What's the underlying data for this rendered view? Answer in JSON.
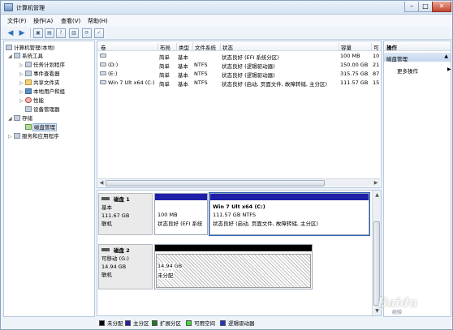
{
  "window": {
    "title": "计算机管理",
    "min": "–",
    "max": "□",
    "close": "✕"
  },
  "menu": [
    {
      "label": "文件(F)"
    },
    {
      "label": "操作(A)"
    },
    {
      "label": "查看(V)"
    },
    {
      "label": "帮助(H)"
    }
  ],
  "toolbar": [
    {
      "icon": "back-arrow-icon",
      "glyph": "◀"
    },
    {
      "icon": "forward-arrow-icon",
      "glyph": "▶"
    },
    {
      "icon": "up-level-icon",
      "glyph": "▣"
    },
    {
      "icon": "show-hide-tree-icon",
      "glyph": "▤"
    },
    {
      "icon": "help-icon",
      "glyph": "?"
    },
    {
      "icon": "properties-icon",
      "glyph": "▥"
    },
    {
      "icon": "refresh-icon",
      "glyph": "⟳"
    },
    {
      "icon": "export-list-icon",
      "glyph": "✓"
    }
  ],
  "tree": [
    {
      "label": "计算机管理(本地)",
      "expander": "",
      "icon": "gray"
    },
    {
      "label": "系统工具",
      "expander": "◢",
      "icon": "gray"
    },
    {
      "label": "任务计划程序",
      "expander": "▷",
      "icon": "gray"
    },
    {
      "label": "事件查看器",
      "expander": "▷",
      "icon": "gray"
    },
    {
      "label": "共享文件夹",
      "expander": "▷",
      "icon": "yellow"
    },
    {
      "label": "本地用户和组",
      "expander": "▷",
      "icon": "blue"
    },
    {
      "label": "性能",
      "expander": "▷",
      "icon": "red"
    },
    {
      "label": "设备管理器",
      "expander": "",
      "icon": "gray"
    },
    {
      "label": "存储",
      "expander": "◢",
      "icon": "gray"
    },
    {
      "label": "磁盘管理",
      "expander": "",
      "icon": "green"
    },
    {
      "label": "服务和应用程序",
      "expander": "▷",
      "icon": "gray"
    }
  ],
  "volumes": {
    "columns": [
      "卷",
      "布局",
      "类型",
      "文件系统",
      "状态",
      "容量",
      "可"
    ],
    "rows": [
      [
        "",
        "简单",
        "基本",
        "",
        "状态良好 (EFI 系统分区)",
        "100 MB",
        "10"
      ],
      [
        "(D:)",
        "简单",
        "基本",
        "NTFS",
        "状态良好 (逻辑驱动器)",
        "150.00 GB",
        "21"
      ],
      [
        "(E:)",
        "简单",
        "基本",
        "NTFS",
        "状态良好 (逻辑驱动器)",
        "315.75 GB",
        "87"
      ],
      [
        "Win 7 Ult x64 (C:)",
        "简单",
        "基本",
        "NTFS",
        "状态良好 (启动, 页面文件, 故障转储, 主分区)",
        "111.57 GB",
        "15"
      ]
    ]
  },
  "disks": [
    {
      "name": "磁盘 1",
      "type": "基本",
      "size": "111.67 GB",
      "status": "联机",
      "partitions": [
        {
          "title": "",
          "size": "100 MB",
          "status": "状态良好 (EFI 系统",
          "color": "#1f1fa8",
          "selected": false
        },
        {
          "title": "Win 7 Ult x64  (C:)",
          "size": "111.57 GB NTFS",
          "status": "状态良好 (启动, 页面文件, 故障转储, 主分区)",
          "color": "#1f1fa8",
          "selected": true
        }
      ]
    },
    {
      "name": "磁盘 2",
      "type": "可移动 (G:)",
      "size": "14.94 GB",
      "status": "联机",
      "partitions": [
        {
          "title": "",
          "size": "14.94 GB",
          "status": "未分配",
          "color": "#000000",
          "selected": false
        }
      ]
    }
  ],
  "actions": {
    "header": "操作",
    "section": "磁盘管理",
    "more": "更多操作"
  },
  "legend": [
    {
      "label": "未分配",
      "color": "#000000"
    },
    {
      "label": "主分区",
      "color": "#1f1fa8"
    },
    {
      "label": "扩展分区",
      "color": "#1c7a1c"
    },
    {
      "label": "可用空间",
      "color": "#41d941"
    },
    {
      "label": "逻辑驱动器",
      "color": "#2233cc"
    }
  ],
  "watermark": {
    "text": "Baidu",
    "sub": "经验"
  }
}
